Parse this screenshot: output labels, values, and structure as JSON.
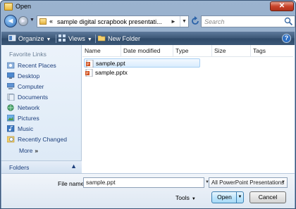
{
  "window": {
    "title": "Open",
    "close_glyph": "✕"
  },
  "navigation": {
    "back_glyph": "◄",
    "forward_glyph": "►",
    "address_chevron": "«",
    "address_path": "sample digital scrapbook presentati...",
    "address_separator": "►",
    "search_placeholder": "Search"
  },
  "toolbar": {
    "organize_label": "Organize",
    "views_label": "Views",
    "new_folder_label": "New Folder",
    "help_glyph": "?"
  },
  "sidebar": {
    "heading": "Favorite Links",
    "items": [
      {
        "label": "Recent Places",
        "icon": "recent-places-icon"
      },
      {
        "label": "Desktop",
        "icon": "desktop-icon"
      },
      {
        "label": "Computer",
        "icon": "computer-icon"
      },
      {
        "label": "Documents",
        "icon": "documents-icon"
      },
      {
        "label": "Network",
        "icon": "network-icon"
      },
      {
        "label": "Pictures",
        "icon": "pictures-icon"
      },
      {
        "label": "Music",
        "icon": "music-icon"
      },
      {
        "label": "Recently Changed",
        "icon": "recently-changed-icon"
      }
    ],
    "more_label": "More",
    "more_glyph": "»",
    "folders_label": "Folders",
    "folders_glyph": "▲"
  },
  "file_list": {
    "columns": [
      "Name",
      "Date modified",
      "Type",
      "Size",
      "Tags"
    ],
    "sort_glyph": "^",
    "files": [
      {
        "name": "sample.ppt",
        "selected": true
      },
      {
        "name": "sample.pptx",
        "selected": false
      }
    ]
  },
  "footer": {
    "file_name_label": "File name:",
    "file_name_value": "sample.ppt",
    "file_type": "All PowerPoint Presentations",
    "tools_label": "Tools",
    "open_label": "Open",
    "cancel_label": "Cancel"
  },
  "colors": {
    "title_gradient": "#9bb3cf",
    "toolbar": "#3d5878",
    "sidebar_bg": "#e4eef8",
    "link_text": "#1d3f7c",
    "selection": "#d9ecfd"
  }
}
